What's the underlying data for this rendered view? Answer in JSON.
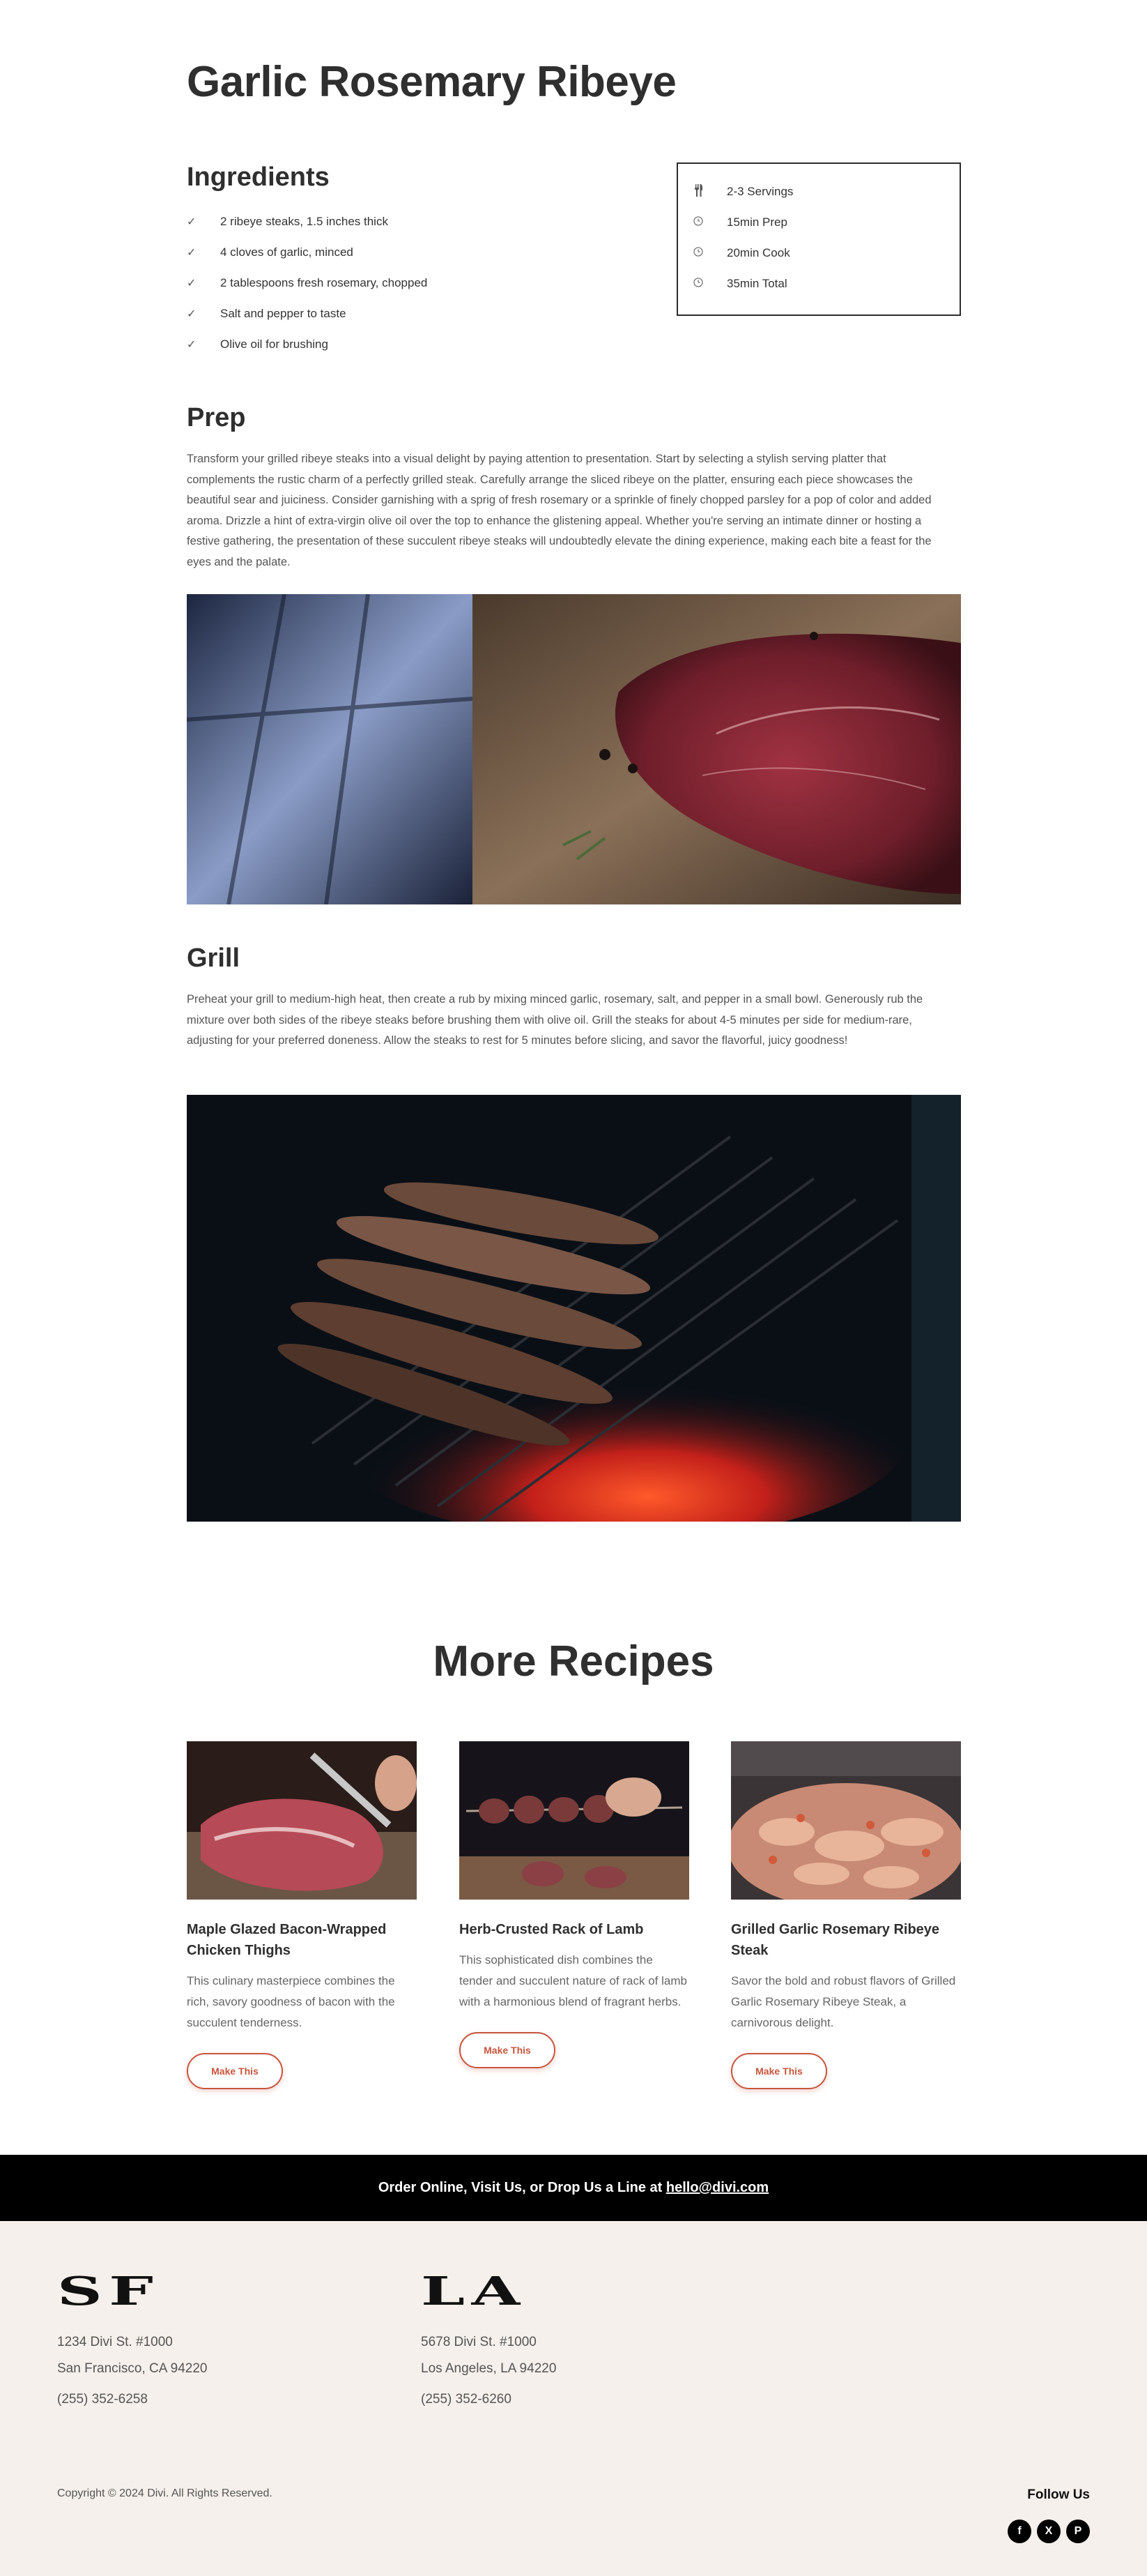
{
  "recipe": {
    "title": "Garlic Rosemary Ribeye",
    "ingredients_heading": "Ingredients",
    "ingredients": [
      "2 ribeye steaks, 1.5 inches thick",
      "4 cloves of garlic, minced",
      "2 tablespoons fresh rosemary, chopped",
      "Salt and pepper to taste",
      "Olive oil for brushing"
    ],
    "info": [
      {
        "icon": "utensils-icon",
        "text": "2-3 Servings"
      },
      {
        "icon": "clock-icon",
        "text": "15min Prep"
      },
      {
        "icon": "clock-icon",
        "text": "20min Cook"
      },
      {
        "icon": "clock-icon",
        "text": "35min Total"
      }
    ]
  },
  "prep": {
    "heading": "Prep",
    "text": "Transform your grilled ribeye steaks into a visual delight by paying attention to presentation. Start by selecting a stylish serving platter that complements the rustic charm of a perfectly grilled steak. Carefully arrange the sliced ribeye on the platter, ensuring each piece showcases the beautiful sear and juiciness. Consider garnishing with a sprig of fresh rosemary or a sprinkle of finely chopped parsley for a pop of color and added aroma. Drizzle a hint of extra-virgin olive oil over the top to enhance the glistening appeal. Whether you're serving an intimate dinner or hosting a festive gathering, the presentation of these succulent ribeye steaks will undoubtedly elevate the dining experience, making each bite a feast for the eyes and the palate."
  },
  "grill": {
    "heading": "Grill",
    "text": "Preheat your grill to medium-high heat, then create a rub by mixing minced garlic, rosemary, salt, and pepper in a small bowl. Generously rub the mixture over both sides of the ribeye steaks before brushing them with olive oil. Grill the steaks for about 4-5 minutes per side for medium-rare, adjusting for your preferred doneness. Allow the steaks to rest for 5 minutes before slicing, and savor the flavorful, juicy goodness!"
  },
  "more": {
    "heading": "More Recipes",
    "cards": [
      {
        "title": "Maple Glazed Bacon-Wrapped Chicken Thighs",
        "desc": "This culinary masterpiece combines the rich, savory goodness of bacon with the succulent tenderness.",
        "button": "Make This"
      },
      {
        "title": "Herb-Crusted Rack of Lamb",
        "desc": "This sophisticated dish combines the tender and succulent nature of rack of lamb with a harmonious blend of fragrant herbs.",
        "button": "Make This"
      },
      {
        "title": "Grilled Garlic Rosemary Ribeye Steak",
        "desc": "Savor the bold and robust flavors of Grilled Garlic Rosemary Ribeye Steak, a carnivorous delight.",
        "button": "Make This"
      }
    ]
  },
  "order_bar": {
    "text": "Order Online, Visit Us, or Drop Us a Line at ",
    "email": "hello@divi.com"
  },
  "footer": {
    "locations": [
      {
        "logo": "SF",
        "address_line1": "1234 Divi St. #1000",
        "address_line2": "San Francisco, CA 94220",
        "phone": "(255) 352-6258"
      },
      {
        "logo": "LA",
        "address_line1": "5678 Divi St. #1000",
        "address_line2": "Los Angeles, LA 94220",
        "phone": "(255) 352-6260"
      }
    ],
    "copyright": "Copyright © 2024 Divi. All Rights Reserved.",
    "follow_label": "Follow Us",
    "socials": [
      {
        "icon": "facebook-icon",
        "glyph": "f"
      },
      {
        "icon": "x-icon",
        "glyph": "X"
      },
      {
        "icon": "pinterest-icon",
        "glyph": "P"
      }
    ]
  }
}
